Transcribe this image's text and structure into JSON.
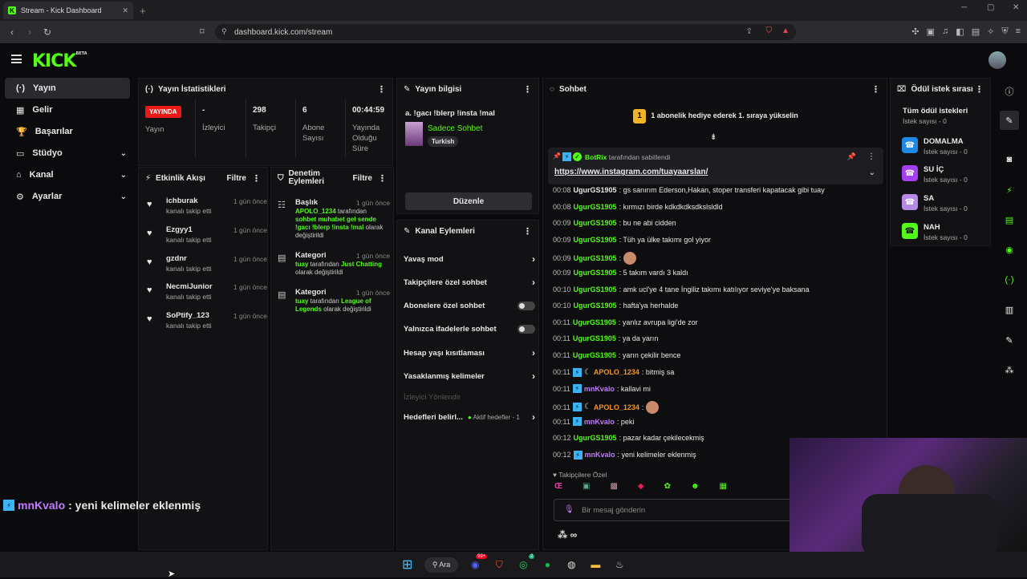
{
  "browser": {
    "tab_title": "Stream - Kick Dashboard",
    "tab_favicon": "K",
    "tab_close": "✕",
    "new_tab": "+",
    "url": "dashboard.kick.com/stream"
  },
  "app": {
    "logo": "KICK",
    "logo_tag": "BETA"
  },
  "sidebar": {
    "items": [
      {
        "label": "Yayın",
        "icon": "(·)"
      },
      {
        "label": "Gelir",
        "icon": "▦"
      },
      {
        "label": "Başarılar",
        "icon": "🏆"
      },
      {
        "label": "Stüdyo",
        "icon": "▭"
      },
      {
        "label": "Kanal",
        "icon": "⌂"
      },
      {
        "label": "Ayarlar",
        "icon": "⚙"
      }
    ]
  },
  "stats": {
    "title": "Yayın İstatistikleri",
    "live_badge": "YAYINDA",
    "live_label": "Yayın",
    "viewers_value": "-",
    "viewers_label": "İzleyici",
    "followers_value": "298",
    "followers_label": "Takipçi",
    "subs_value": "6",
    "subs_label": "Abone Sayısı",
    "uptime_value": "00:44:59",
    "uptime_label": "Yayında Olduğu Süre"
  },
  "stream_info": {
    "title": "Yayın bilgisi",
    "stream_title": "a. !gacı !blerp !insta !mal",
    "category": "Sadece Sohbet",
    "language": "Turkish",
    "edit_button": "Düzenle"
  },
  "activity": {
    "title": "Etkinlik Akışı",
    "filter": "Filtre",
    "items": [
      {
        "name": "ichburak",
        "sub": "kanalı takip etti",
        "time": "1 gün önce"
      },
      {
        "name": "Ezgyy1",
        "sub": "kanalı takip etti",
        "time": "1 gün önce"
      },
      {
        "name": "gzdnr",
        "sub": "kanalı takip etti",
        "time": "1 gün önce"
      },
      {
        "name": "NecmiJunior",
        "sub": "kanalı takip etti",
        "time": "1 gün önce"
      },
      {
        "name": "SoPtify_123",
        "sub": "kanalı takip etti",
        "time": "1 gün önce"
      }
    ]
  },
  "moderation": {
    "title": "Denetim Eylemleri",
    "filter": "Filtre",
    "items": [
      {
        "title": "Başlık",
        "time": "1 gün önce",
        "actor": "APOLO_1234",
        "text1": " tarafından ",
        "value": "sohbet muhabet gel sende !gacı !blerp !insta !mal",
        "text2": " olarak değiştirildi"
      },
      {
        "title": "Kategori",
        "time": "1 gün önce",
        "actor": "tuay",
        "text1": " tarafından ",
        "value": "Just Chatting",
        "text2": " olarak değiştirildi"
      },
      {
        "title": "Kategori",
        "time": "1 gün önce",
        "actor": "tuay",
        "text1": " tarafından ",
        "value": "League of Legends",
        "text2": " olarak değiştirildi"
      }
    ]
  },
  "channel_actions": {
    "title": "Kanal Eylemleri",
    "rows": [
      {
        "label": "Yavaş mod",
        "control": "arrow"
      },
      {
        "label": "Takipçilere özel sohbet",
        "control": "arrow"
      },
      {
        "label": "Abonelere özel sohbet",
        "control": "toggle"
      },
      {
        "label": "Yalnızca ifadelerle sohbet",
        "control": "toggle"
      },
      {
        "label": "Hesap yaşı kısıtlaması",
        "control": "arrow"
      },
      {
        "label": "Yasaklanmış kelimeler",
        "control": "arrow"
      }
    ],
    "redirect_label": "İzleyici Yönlendir",
    "goals_label": "Hedefleri belirl...",
    "goals_status": "Aktif hedefler - 1"
  },
  "chat": {
    "title": "Sohbet",
    "promo_text": "1 abonelik hediye ederek 1. sıraya yükselin",
    "promo_badge": "1",
    "pinned_by": "BotRix",
    "pinned_suffix": " tarafından sabitlendi",
    "pinned_link": "https://www.instagram.com/tuayaarslan/",
    "messages": [
      {
        "time": "00:08",
        "user": "UgurGS1905",
        "color": "w",
        "text": ": gs sanırım Ederson,Hakan, stoper transferi kapatacak gibi tuay",
        "badges": ""
      },
      {
        "time": "00:08",
        "user": "UgurGS1905",
        "color": "g",
        "text": ": kırmızı birde kdkdkdksdkslsldld",
        "badges": ""
      },
      {
        "time": "00:09",
        "user": "UgurGS1905",
        "color": "g",
        "text": ": bu ne abi cidden",
        "badges": ""
      },
      {
        "time": "00:09",
        "user": "UgurGS1905",
        "color": "g",
        "text": ": Tüh ya ülke takımı gol yiyor",
        "badges": ""
      },
      {
        "time": "00:09",
        "user": "UgurGS1905",
        "color": "g",
        "text": ": ",
        "badges": "",
        "emote": true
      },
      {
        "time": "00:09",
        "user": "UgurGS1905",
        "color": "g",
        "text": ": 5 takım vardı 3 kaldı",
        "badges": ""
      },
      {
        "time": "00:10",
        "user": "UgurGS1905",
        "color": "g",
        "text": ": amk ucl'ye 4 tane İngiliz takımı katılıyor seviye'ye baksana",
        "badges": ""
      },
      {
        "time": "00:10",
        "user": "UgurGS1905",
        "color": "g",
        "text": ": hafta'ya herhalde",
        "badges": ""
      },
      {
        "time": "00:11",
        "user": "UgurGS1905",
        "color": "g",
        "text": ": yanlız avrupa ligi'de zor",
        "badges": ""
      },
      {
        "time": "00:11",
        "user": "UgurGS1905",
        "color": "g",
        "text": ": ya da yarın",
        "badges": ""
      },
      {
        "time": "00:11",
        "user": "UgurGS1905",
        "color": "g",
        "text": ": yarın çekilir bence",
        "badges": ""
      },
      {
        "time": "00:11",
        "user": "APOLO_1234",
        "color": "o",
        "text": ": bitmiş sa",
        "badges": "bm"
      },
      {
        "time": "00:11",
        "user": "mnKvalo",
        "color": "p",
        "text": ": kallavi mi",
        "badges": "b"
      },
      {
        "time": "00:11",
        "user": "APOLO_1234",
        "color": "o",
        "text": ": ",
        "badges": "bm",
        "emote": true
      },
      {
        "time": "00:11",
        "user": "mnKvalo",
        "color": "p",
        "text": ": peki",
        "badges": "b"
      },
      {
        "time": "00:12",
        "user": "UgurGS1905",
        "color": "g",
        "text": ": pazar kadar çekilecekmiş",
        "badges": ""
      },
      {
        "time": "00:12",
        "user": "mnKvalo",
        "color": "p",
        "text": ": yeni kelimeler eklenmiş",
        "badges": "b"
      }
    ],
    "followers_only": "Takipçilere Özel",
    "input_placeholder": "Bir mesaj gönderin",
    "infinity": "∞"
  },
  "rewards": {
    "title": "Ödül istek sırası",
    "all_label": "Tüm ödül istekleri",
    "all_count": "İstek sayısı - 0",
    "items": [
      {
        "name": "DOMALMA",
        "count": "İstek sayısı - 0",
        "color": "#1e88e5"
      },
      {
        "name": "SU İÇ",
        "count": "İstek sayısı - 0",
        "color": "#a53ef0"
      },
      {
        "name": "SA",
        "count": "İstek sayısı - 0",
        "color": "#b58ae6"
      },
      {
        "name": "NAH",
        "count": "İstek sayısı - 0",
        "color": "#53fc18"
      }
    ]
  },
  "overlay": {
    "user": "mnKvalo",
    "text": " : yeni kelimeler eklenmiş"
  },
  "taskbar": {
    "search_label": "Ara",
    "discord_badge": "99+",
    "whatsapp_badge": "2"
  },
  "colors": {
    "kick_green": "#53fc18",
    "live_red": "#e91916",
    "panel_bg": "#121214"
  }
}
